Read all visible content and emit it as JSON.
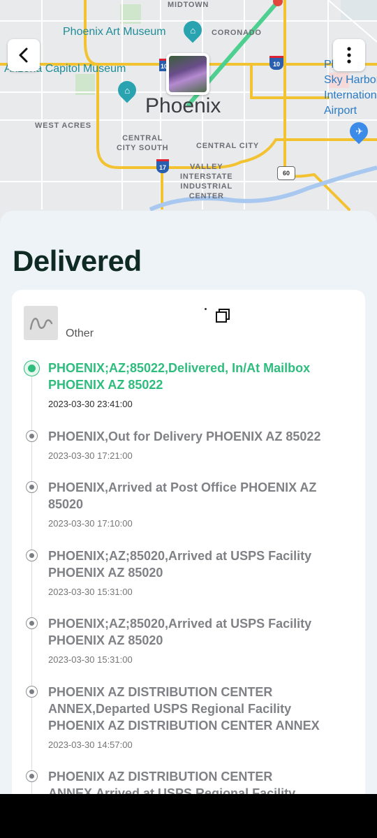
{
  "map": {
    "city_label": "Phoenix",
    "labels": {
      "midtown": "MIDTOWN",
      "art_museum": "Phoenix Art Museum",
      "coronado": "CORONADO",
      "capitol_museum": "Arizona Capitol Museum",
      "sky_harbor": "Phoenix\nSky Harbor\nInternational\nAirport",
      "west_acres": "WEST ACRES",
      "central_city_south": "CENTRAL\nCITY SOUTH",
      "central_city": "CENTRAL CITY",
      "valley_interstate": "VALLEY\nINTERSTATE\nINDUSTRIAL\nCENTER"
    },
    "shields": {
      "i10_left": "10",
      "i10_right": "10",
      "i17": "17",
      "az60": "60"
    },
    "icons": {
      "back": "chevron-left-icon",
      "more": "more-vertical-icon",
      "museum": "museum-icon",
      "airport": "airplane-icon"
    }
  },
  "status": "Delivered",
  "carrier": {
    "name": "Other",
    "logo_icon": "carrier-logo-icon"
  },
  "events": [
    {
      "description": "PHOENIX;AZ;85022,Delivered, In/At Mailbox PHOENIX AZ 85022",
      "time": "2023-03-30 23:41:00",
      "active": true
    },
    {
      "description": "PHOENIX,Out for Delivery PHOENIX AZ 85022",
      "time": "2023-03-30 17:21:00",
      "active": false
    },
    {
      "description": "PHOENIX,Arrived at Post Office PHOENIX AZ 85020",
      "time": "2023-03-30 17:10:00",
      "active": false
    },
    {
      "description": "PHOENIX;AZ;85020,Arrived at USPS Facility PHOENIX AZ 85020",
      "time": "2023-03-30 15:31:00",
      "active": false
    },
    {
      "description": "PHOENIX;AZ;85020,Arrived at USPS Facility PHOENIX AZ 85020",
      "time": "2023-03-30 15:31:00",
      "active": false
    },
    {
      "description": "PHOENIX AZ DISTRIBUTION CENTER ANNEX,Departed USPS Regional Facility PHOENIX AZ DISTRIBUTION CENTER ANNEX",
      "time": "2023-03-30 14:57:00",
      "active": false
    },
    {
      "description": "PHOENIX AZ DISTRIBUTION CENTER ANNEX,Arrived at USPS Regional Facility",
      "time": "",
      "active": false
    }
  ],
  "colors": {
    "accent_green": "#2ebd7d",
    "title_dark": "#0f2a22",
    "road_yellow": "#f2c230",
    "route_green": "#4ccf8f"
  }
}
